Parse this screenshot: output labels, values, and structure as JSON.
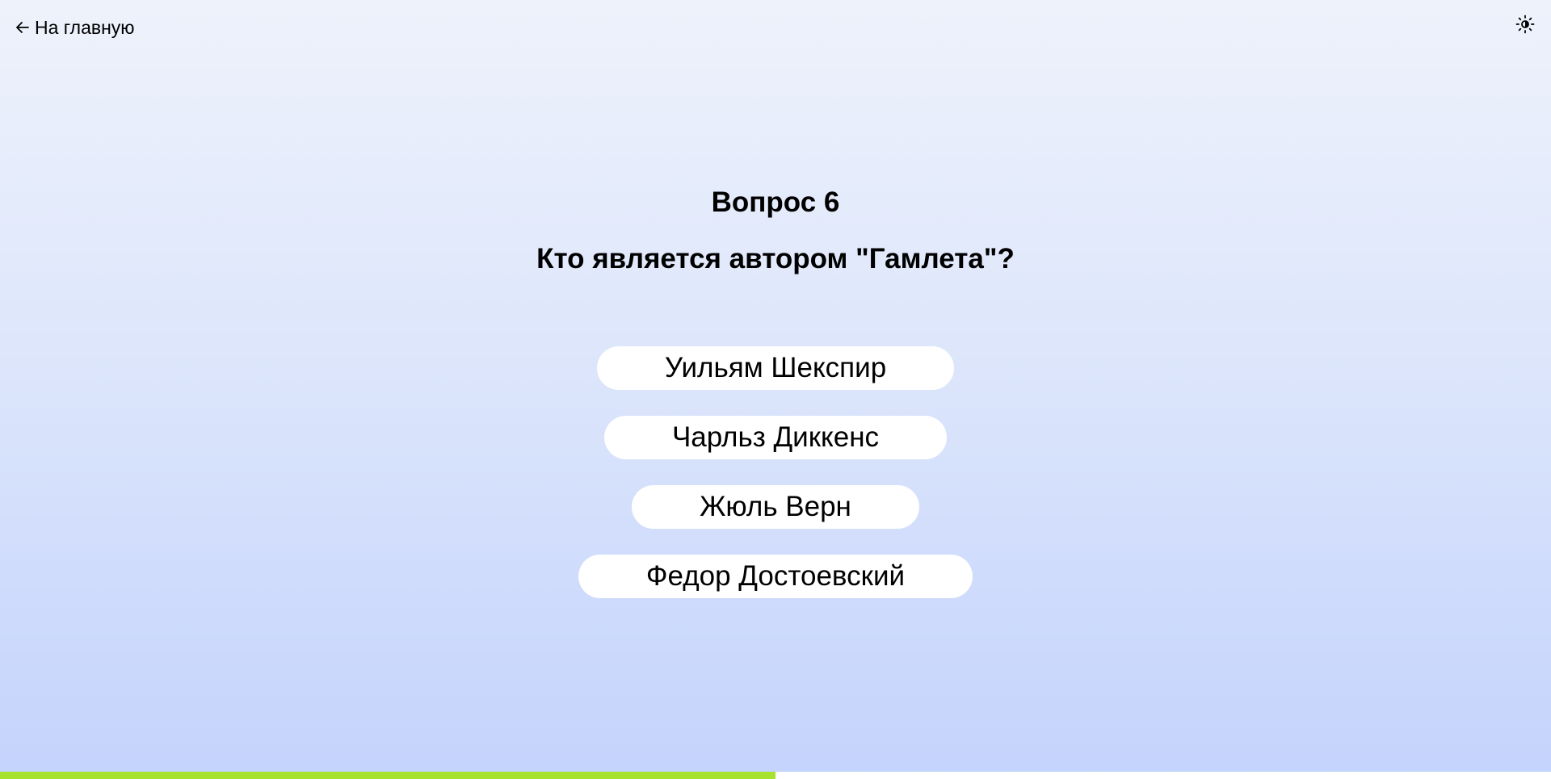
{
  "nav": {
    "back_label": "На главную",
    "back_icon": "arrow-left-icon",
    "theme_icon": "sun-icon"
  },
  "quiz": {
    "question_label": "Вопрос 6",
    "question_text": "Кто является автором \"Гамлета\"?",
    "answers": [
      "Уильям Шекспир",
      "Чарльз Диккенс",
      "Жюль Верн",
      "Федор Достоевский"
    ]
  },
  "progress": {
    "fraction": 0.5
  },
  "colors": {
    "progress_fill": "#a6e22e",
    "progress_track": "#ffffff",
    "button_bg": "#ffffff",
    "background_top": "#eef2fb",
    "background_bottom": "#c4d3fc"
  }
}
